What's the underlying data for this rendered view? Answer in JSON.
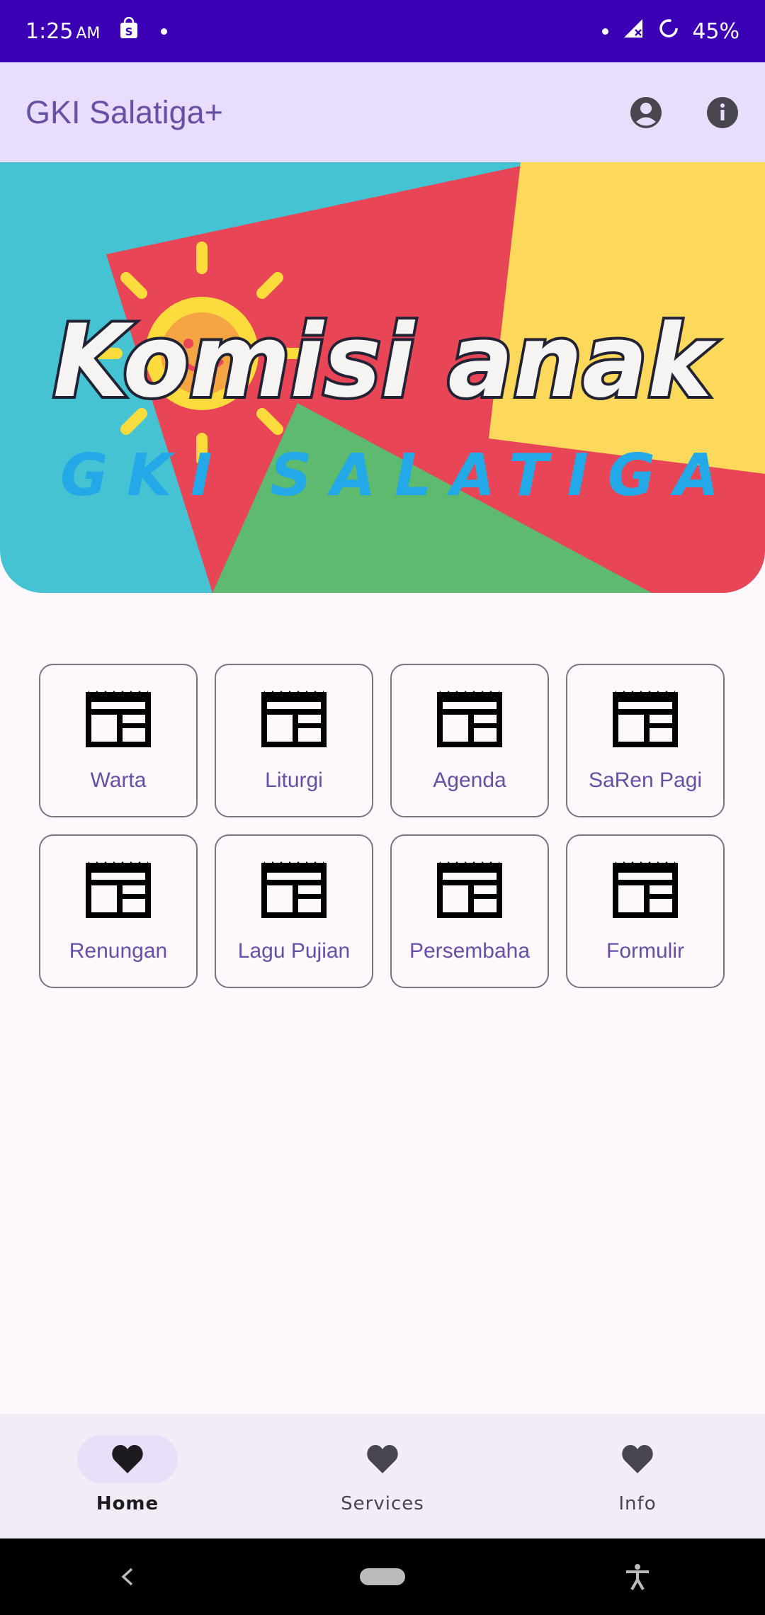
{
  "status_bar": {
    "time": "1:25",
    "ampm": "AM",
    "battery": "45%",
    "icons": [
      "shopping-bag-icon",
      "notification-dot-icon",
      "signal-off-icon",
      "battery-saver-icon"
    ]
  },
  "app_bar": {
    "title": "GKI Salatiga+",
    "actions": [
      "account-circle-icon",
      "info-icon"
    ]
  },
  "banner": {
    "headline": "Komisi anak",
    "subline": "GKI SALATIGA"
  },
  "menu": [
    {
      "label": "Warta",
      "icon": "article-icon"
    },
    {
      "label": "Liturgi",
      "icon": "article-icon"
    },
    {
      "label": "Agenda",
      "icon": "article-icon"
    },
    {
      "label": "SaRen Pagi",
      "icon": "article-icon"
    },
    {
      "label": "Renungan",
      "icon": "article-icon"
    },
    {
      "label": "Lagu Pujian",
      "icon": "article-icon"
    },
    {
      "label": "Persembaha",
      "icon": "article-icon"
    },
    {
      "label": "Formulir",
      "icon": "article-icon"
    }
  ],
  "bottom_nav": {
    "items": [
      {
        "label": "Home",
        "icon": "heart-icon",
        "active": true
      },
      {
        "label": "Services",
        "icon": "heart-icon",
        "active": false
      },
      {
        "label": "Info",
        "icon": "heart-icon",
        "active": false
      }
    ]
  },
  "colors": {
    "status_bar": "#3b00b3",
    "app_bar": "#e8ddfc",
    "accent_text": "#6650a4",
    "background": "#fef7fc",
    "nav_bar": "#f2ecf6"
  }
}
